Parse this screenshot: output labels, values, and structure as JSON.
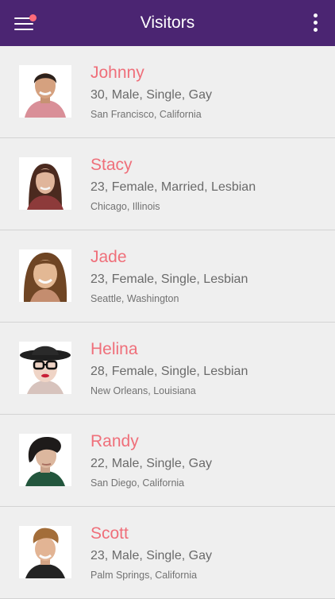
{
  "app_bar": {
    "title": "Visitors",
    "menu_icon": "hamburger-menu-icon",
    "more_icon": "more-vertical-icon",
    "notification_color": "#ff6b7a",
    "background": "#4b2572"
  },
  "colors": {
    "name": "#ef6f7a",
    "details": "#6a6a6a",
    "location": "#727272",
    "divider": "#d3d3d3"
  },
  "visitors": [
    {
      "name": "Johnny",
      "details": "30, Male, Single, Gay",
      "location": "San Francisco, California",
      "avatar_icon": "man-avatar-icon"
    },
    {
      "name": "Stacy",
      "details": "23, Female, Married, Lesbian",
      "location": "Chicago, Illinois",
      "avatar_icon": "woman-avatar-icon"
    },
    {
      "name": "Jade",
      "details": "23, Female, Single, Lesbian",
      "location": "Seattle, Washington",
      "avatar_icon": "woman-avatar-icon"
    },
    {
      "name": "Helina",
      "details": "28, Female, Single, Lesbian",
      "location": "New Orleans, Louisiana",
      "avatar_icon": "woman-hat-glasses-avatar-icon"
    },
    {
      "name": "Randy",
      "details": "22, Male, Single, Gay",
      "location": "San Diego, California",
      "avatar_icon": "man-avatar-icon"
    },
    {
      "name": "Scott",
      "details": "23, Male, Single, Gay",
      "location": "Palm Springs, California",
      "avatar_icon": "man-avatar-icon"
    }
  ]
}
